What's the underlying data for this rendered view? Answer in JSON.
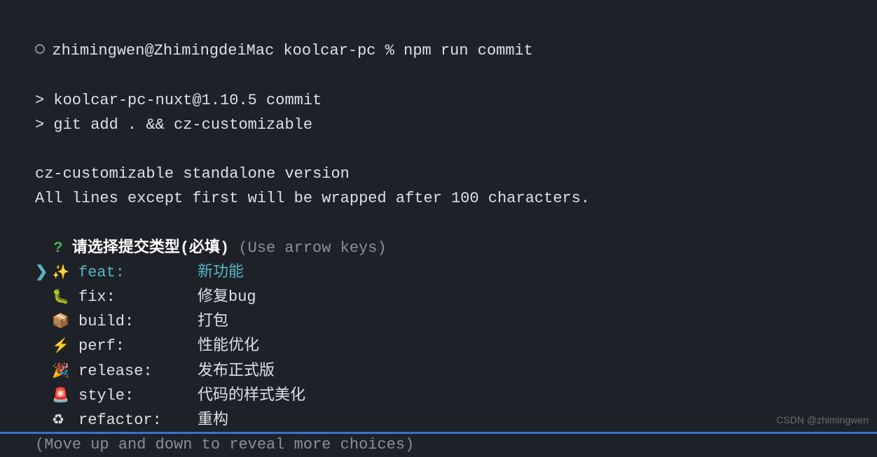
{
  "prompt": {
    "user": "zhimingwen",
    "host": "ZhimingdeiMac",
    "dir": "koolcar-pc",
    "symbol": "%",
    "command": "npm run commit"
  },
  "outputLines": [
    "> koolcar-pc-nuxt@1.10.5 commit",
    "> git add . && cz-customizable"
  ],
  "czInfo": [
    "cz-customizable standalone version",
    "All lines except first will be wrapped after 100 characters."
  ],
  "question": {
    "marker": "?",
    "text": "请选择提交类型(必填)",
    "hint": "(Use arrow keys)"
  },
  "options": [
    {
      "marker": "❯",
      "emoji": "✨",
      "type": "feat:",
      "desc": "新功能",
      "selected": true
    },
    {
      "marker": "",
      "emoji": "🐛",
      "type": "fix:",
      "desc": "修复bug",
      "selected": false
    },
    {
      "marker": "",
      "emoji": "📦",
      "type": "build:",
      "desc": "打包",
      "selected": false
    },
    {
      "marker": "",
      "emoji": "⚡",
      "type": "perf:",
      "desc": "性能优化",
      "selected": false
    },
    {
      "marker": "",
      "emoji": "🎉",
      "type": "release:",
      "desc": "发布正式版",
      "selected": false
    },
    {
      "marker": "",
      "emoji": "🚨",
      "type": "style:",
      "desc": "代码的样式美化",
      "selected": false
    },
    {
      "marker": "",
      "emoji": "♻",
      "type": "refactor:",
      "desc": "重构",
      "selected": false
    }
  ],
  "footerHint": "(Move up and down to reveal more choices)",
  "watermark": "CSDN @zhimingwen"
}
